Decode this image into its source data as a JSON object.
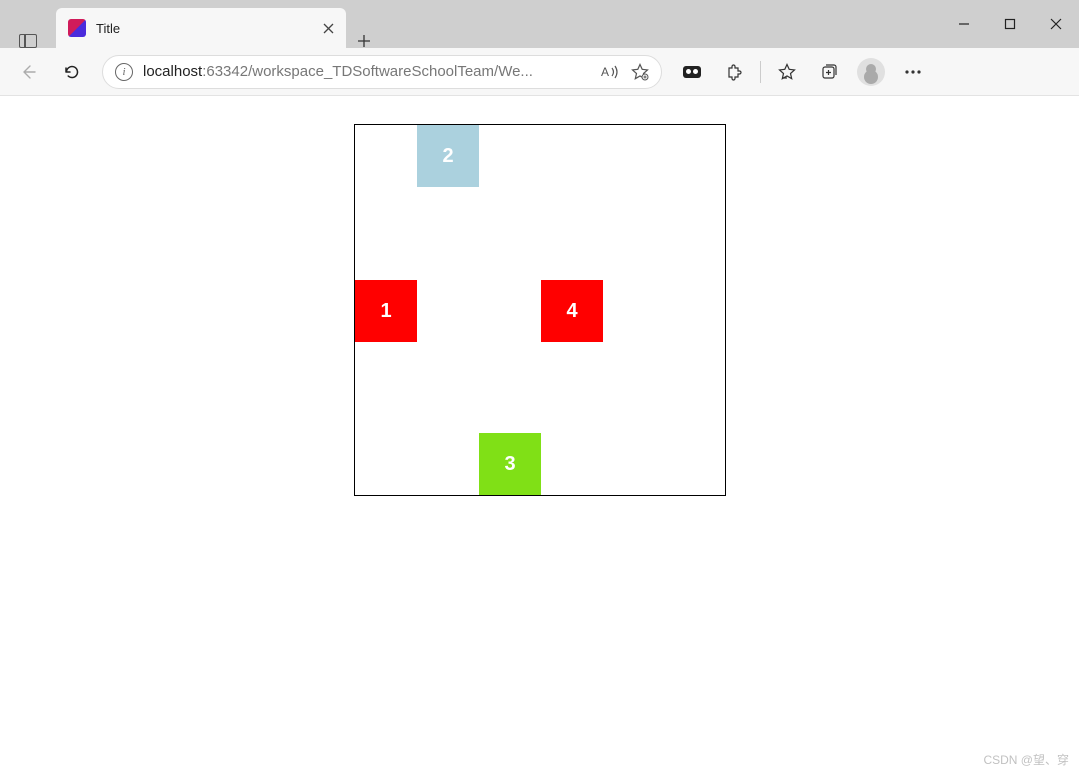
{
  "browser": {
    "tab_title": "Title",
    "url_host": "localhost",
    "url_path": ":63342/workspace_TDSoftwareSchoolTeam/We..."
  },
  "boxes": {
    "b1": "1",
    "b2": "2",
    "b3": "3",
    "b4": "4"
  },
  "colors": {
    "red": "#ff0000",
    "lightblue": "#abd1de",
    "green": "#80e016"
  },
  "watermark": "CSDN @望、穿"
}
